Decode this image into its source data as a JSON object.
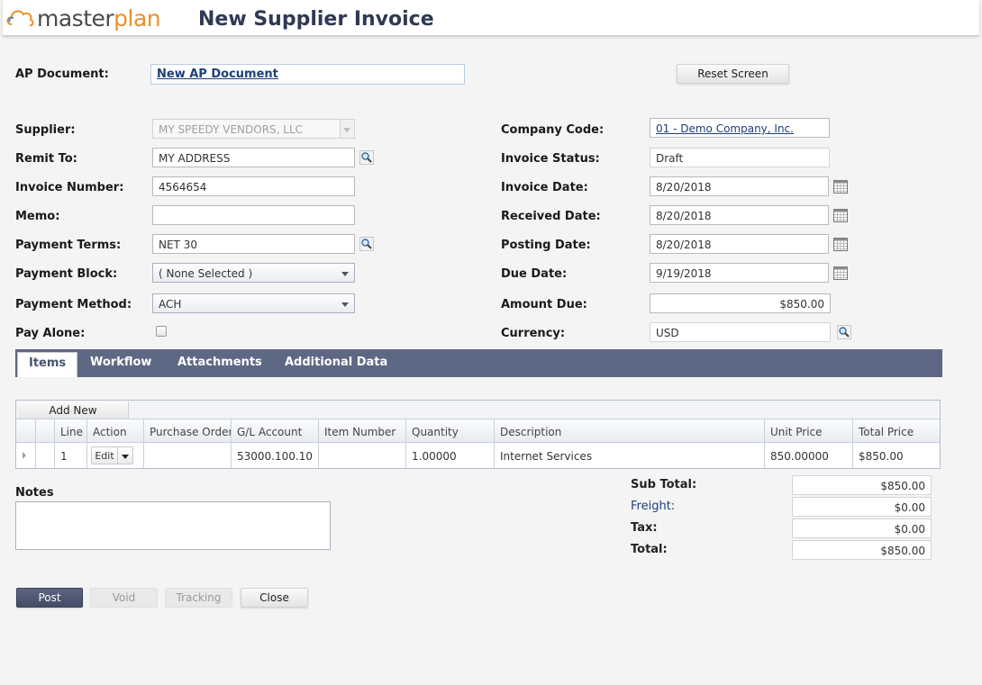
{
  "app": {
    "logo_part1": "master",
    "logo_part2": "plan",
    "page_title": "New Supplier Invoice"
  },
  "header_form": {
    "ap_document_label": "AP Document:",
    "ap_document_value": "New AP Document",
    "reset_label": "Reset Screen"
  },
  "left_fields": {
    "supplier_label": "Supplier:",
    "supplier_value": "MY SPEEDY VENDORS, LLC",
    "remit_label": "Remit To:",
    "remit_value": "MY ADDRESS",
    "invoice_number_label": "Invoice Number:",
    "invoice_number_value": "4564654",
    "memo_label": "Memo:",
    "memo_value": "",
    "terms_label": "Payment Terms:",
    "terms_value": "NET 30",
    "block_label": "Payment Block:",
    "block_value": "( None Selected )",
    "method_label": "Payment Method:",
    "method_value": "ACH",
    "pay_alone_label": "Pay Alone:"
  },
  "right_fields": {
    "company_label": "Company Code:",
    "company_value": "01 - Demo Company, Inc.",
    "status_label": "Invoice Status:",
    "status_value": "Draft",
    "invoice_date_label": "Invoice Date:",
    "invoice_date_value": "8/20/2018",
    "received_label": "Received Date:",
    "received_value": "8/20/2018",
    "posting_label": "Posting Date:",
    "posting_value": "8/20/2018",
    "due_label": "Due Date:",
    "due_value": "9/19/2018",
    "amount_label": "Amount Due:",
    "amount_value": "$850.00",
    "currency_label": "Currency:",
    "currency_value": "USD"
  },
  "tabs": [
    "Items",
    "Workflow",
    "Attachments",
    "Additional Data"
  ],
  "grid": {
    "add_new": "Add New",
    "columns": [
      "Line",
      "Action",
      "Purchase Order",
      "G/L Account",
      "Item Number",
      "Quantity",
      "Description",
      "Unit Price",
      "Total Price"
    ],
    "rows": [
      {
        "line": "1",
        "action": "Edit",
        "purchase_order": "",
        "gl_account": "53000.100.10",
        "item_number": "",
        "quantity": "1.00000",
        "description": "Internet Services",
        "unit_price": "850.00000",
        "total_price": "$850.00"
      }
    ]
  },
  "notes_label": "Notes",
  "totals": {
    "subtotal_label": "Sub Total:",
    "subtotal_value": "$850.00",
    "freight_label": "Freight:",
    "freight_value": "$0.00",
    "tax_label": "Tax:",
    "tax_value": "$0.00",
    "total_label": "Total:",
    "total_value": "$850.00"
  },
  "actions": {
    "post": "Post",
    "void": "Void",
    "tracking": "Tracking",
    "close": "Close"
  }
}
